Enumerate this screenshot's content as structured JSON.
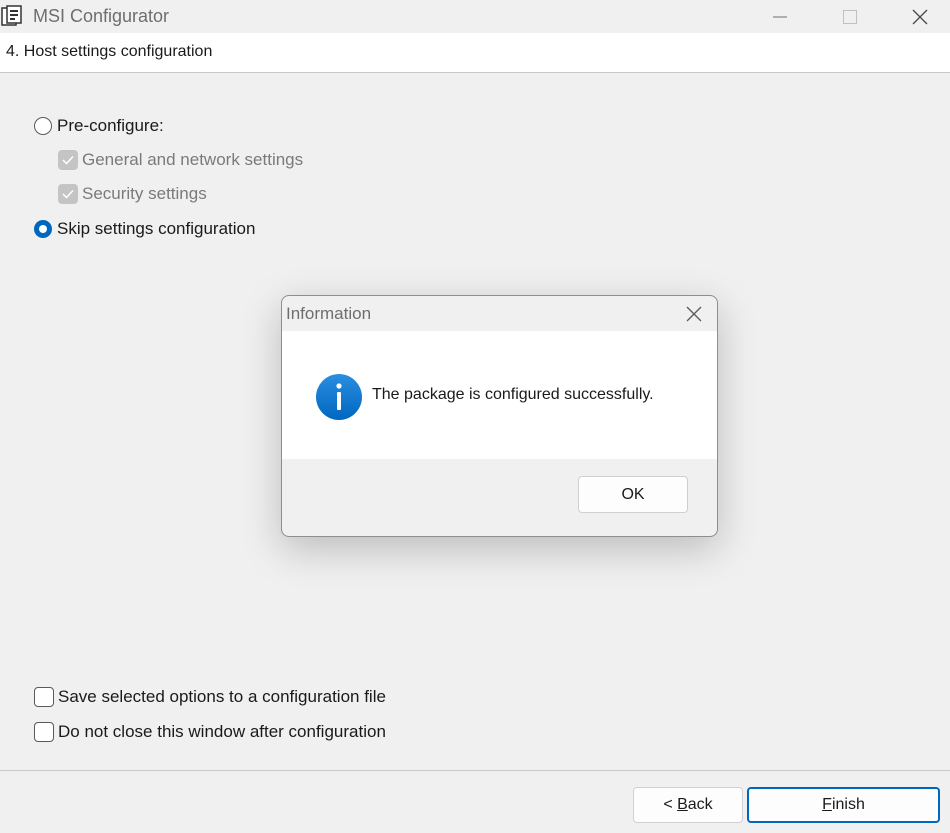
{
  "window": {
    "title": "MSI Configurator",
    "controls": [
      "minimize-icon",
      "maximize-icon",
      "close-icon"
    ]
  },
  "header": {
    "step_title": "4. Host settings configuration"
  },
  "options": {
    "preconfigure": {
      "label": "Pre-configure:",
      "selected": false
    },
    "general_network": {
      "label": "General and network settings",
      "checked": true,
      "enabled": false
    },
    "security": {
      "label": "Security settings",
      "checked": true,
      "enabled": false
    },
    "skip": {
      "label": "Skip settings configuration",
      "selected": true
    }
  },
  "bottom_options": {
    "save_file": {
      "label": "Save selected options to a configuration file",
      "checked": false
    },
    "keep_open": {
      "label": "Do not close this window after configuration",
      "checked": false
    }
  },
  "dialog": {
    "title": "Information",
    "message": "The package is configured successfully.",
    "icon": "info-icon",
    "ok_label": "OK"
  },
  "footer": {
    "back_prefix": "< ",
    "back_key": "B",
    "back_rest": "ack",
    "finish_key": "F",
    "finish_rest": "inish"
  },
  "colors": {
    "accent": "#0067c0",
    "background": "#f0f0f0",
    "disabled_check": "#c4c4c4"
  }
}
